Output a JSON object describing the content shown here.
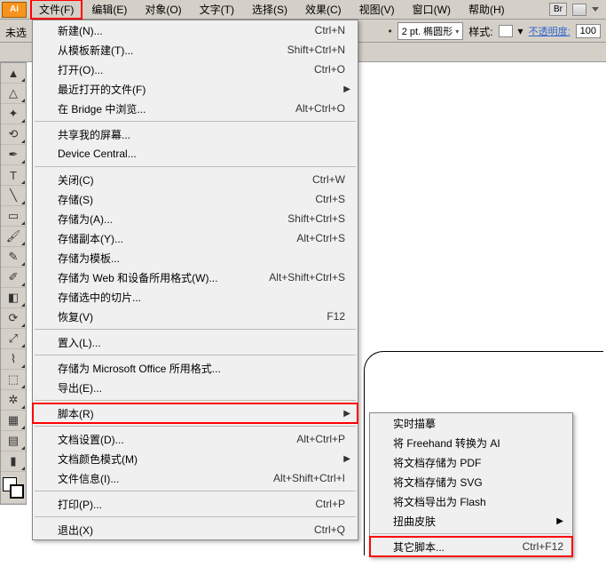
{
  "menubar": {
    "items": [
      "文件(F)",
      "编辑(E)",
      "对象(O)",
      "文字(T)",
      "选择(S)",
      "效果(C)",
      "视图(V)",
      "窗口(W)",
      "帮助(H)"
    ],
    "br_label": "Br"
  },
  "toolbar": {
    "untitled": "未选",
    "stroke_weight": "2 pt. 椭圆形",
    "style_label": "样式:",
    "opacity_label": "不透明度:",
    "opacity_value": "100"
  },
  "file_menu": [
    {
      "label": "新建(N)...",
      "shortcut": "Ctrl+N"
    },
    {
      "label": "从模板新建(T)...",
      "shortcut": "Shift+Ctrl+N"
    },
    {
      "label": "打开(O)...",
      "shortcut": "Ctrl+O"
    },
    {
      "label": "最近打开的文件(F)",
      "arrow": true
    },
    {
      "label": "在 Bridge 中浏览...",
      "shortcut": "Alt+Ctrl+O"
    },
    {
      "sep": true
    },
    {
      "label": "共享我的屏幕..."
    },
    {
      "label": "Device Central..."
    },
    {
      "sep": true
    },
    {
      "label": "关闭(C)",
      "shortcut": "Ctrl+W"
    },
    {
      "label": "存储(S)",
      "shortcut": "Ctrl+S"
    },
    {
      "label": "存储为(A)...",
      "shortcut": "Shift+Ctrl+S"
    },
    {
      "label": "存储副本(Y)...",
      "shortcut": "Alt+Ctrl+S"
    },
    {
      "label": "存储为模板..."
    },
    {
      "label": "存储为 Web 和设备所用格式(W)...",
      "shortcut": "Alt+Shift+Ctrl+S"
    },
    {
      "label": "存储选中的切片..."
    },
    {
      "label": "恢复(V)",
      "shortcut": "F12"
    },
    {
      "sep": true
    },
    {
      "label": "置入(L)..."
    },
    {
      "sep": true
    },
    {
      "label": "存储为 Microsoft Office 所用格式..."
    },
    {
      "label": "导出(E)..."
    },
    {
      "sep": true
    },
    {
      "label": "脚本(R)",
      "arrow": true,
      "highlight": true
    },
    {
      "sep": true
    },
    {
      "label": "文档设置(D)...",
      "shortcut": "Alt+Ctrl+P"
    },
    {
      "label": "文档颜色模式(M)",
      "arrow": true
    },
    {
      "label": "文件信息(I)...",
      "shortcut": "Alt+Shift+Ctrl+I"
    },
    {
      "sep": true
    },
    {
      "label": "打印(P)...",
      "shortcut": "Ctrl+P"
    },
    {
      "sep": true
    },
    {
      "label": "退出(X)",
      "shortcut": "Ctrl+Q"
    }
  ],
  "script_submenu": [
    {
      "label": "实时描摹"
    },
    {
      "label": "将 Freehand 转换为 AI"
    },
    {
      "label": "将文档存储为 PDF"
    },
    {
      "label": "将文档存储为 SVG"
    },
    {
      "label": "将文档导出为 Flash"
    },
    {
      "label": "扭曲皮肤",
      "arrow": true
    },
    {
      "sep": true
    },
    {
      "label": "其它脚本...",
      "shortcut": "Ctrl+F12",
      "highlight": true
    }
  ],
  "tools": [
    {
      "name": "selection-tool",
      "glyph": "▲"
    },
    {
      "name": "direct-selection-tool",
      "glyph": "△"
    },
    {
      "name": "magic-wand-tool",
      "glyph": "✦"
    },
    {
      "name": "lasso-tool",
      "glyph": "⟲"
    },
    {
      "name": "pen-tool",
      "glyph": "✒"
    },
    {
      "name": "type-tool",
      "glyph": "T"
    },
    {
      "name": "line-tool",
      "glyph": "╲"
    },
    {
      "name": "rectangle-tool",
      "glyph": "▭"
    },
    {
      "name": "paintbrush-tool",
      "glyph": "🖌"
    },
    {
      "name": "pencil-tool",
      "glyph": "✎"
    },
    {
      "name": "blob-brush-tool",
      "glyph": "✐"
    },
    {
      "name": "eraser-tool",
      "glyph": "◧"
    },
    {
      "name": "rotate-tool",
      "glyph": "⟳"
    },
    {
      "name": "scale-tool",
      "glyph": "⤢"
    },
    {
      "name": "warp-tool",
      "glyph": "⌇"
    },
    {
      "name": "free-transform-tool",
      "glyph": "⬚"
    },
    {
      "name": "symbol-sprayer-tool",
      "glyph": "✲"
    },
    {
      "name": "graph-tool",
      "glyph": "▦"
    },
    {
      "name": "mesh-tool",
      "glyph": "▤"
    },
    {
      "name": "gradient-tool",
      "glyph": "▮"
    }
  ]
}
